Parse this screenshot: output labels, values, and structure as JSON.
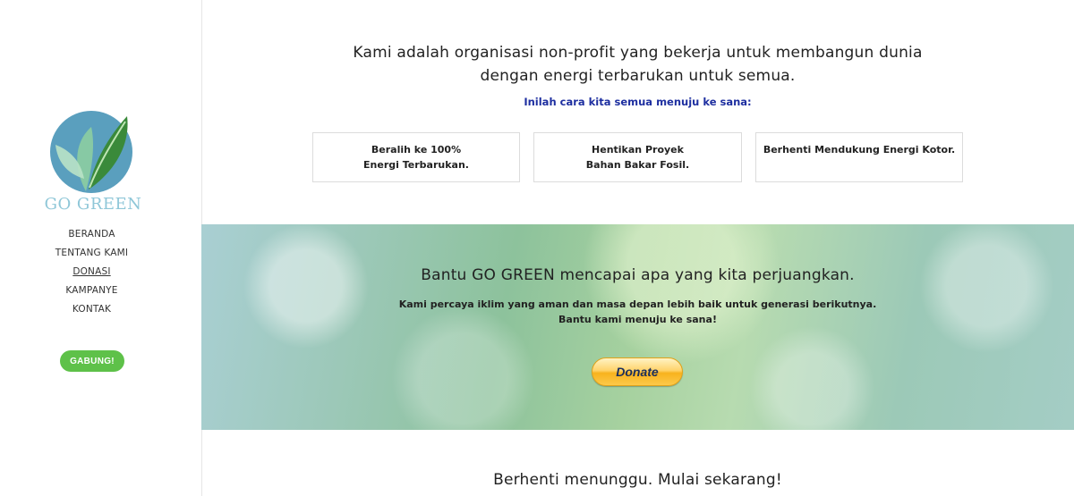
{
  "brand": {
    "logo_text": "GO GREEN"
  },
  "nav": {
    "items": [
      {
        "label": "BERANDA"
      },
      {
        "label": "TENTANG KAMI"
      },
      {
        "label": "DONASI"
      },
      {
        "label": "KAMPANYE"
      },
      {
        "label": "KONTAK"
      }
    ],
    "active_label": "DONASI",
    "join_label": "GABUNG!"
  },
  "intro": {
    "mission": "Kami adalah organisasi non-profit yang bekerja untuk membangun dunia dengan energi terbarukan untuk semua.",
    "how": "Inilah cara kita semua menuju ke sana:"
  },
  "goals": [
    {
      "line1": "Beralih ke 100%",
      "line2": "Energi Terbarukan."
    },
    {
      "line1": "Hentikan Proyek",
      "line2": "Bahan Bakar Fosil."
    },
    {
      "line1": "Berhenti Mendukung Energi Kotor.",
      "line2": ""
    }
  ],
  "banner": {
    "title": "Bantu GO GREEN mencapai apa yang kita perjuangkan.",
    "line1": "Kami percaya iklim yang aman dan masa depan lebih baik untuk generasi berikutnya.",
    "line2": "Bantu kami menuju ke sana!",
    "donate_label": "Donate"
  },
  "closing": {
    "title": "Berhenti menunggu. Mulai sekarang!"
  },
  "colors": {
    "accent_green": "#5ec149",
    "link_blue": "#1e2fa0",
    "logo_circle": "#5a9fbe",
    "leaf_green": "#3a8a3a"
  }
}
